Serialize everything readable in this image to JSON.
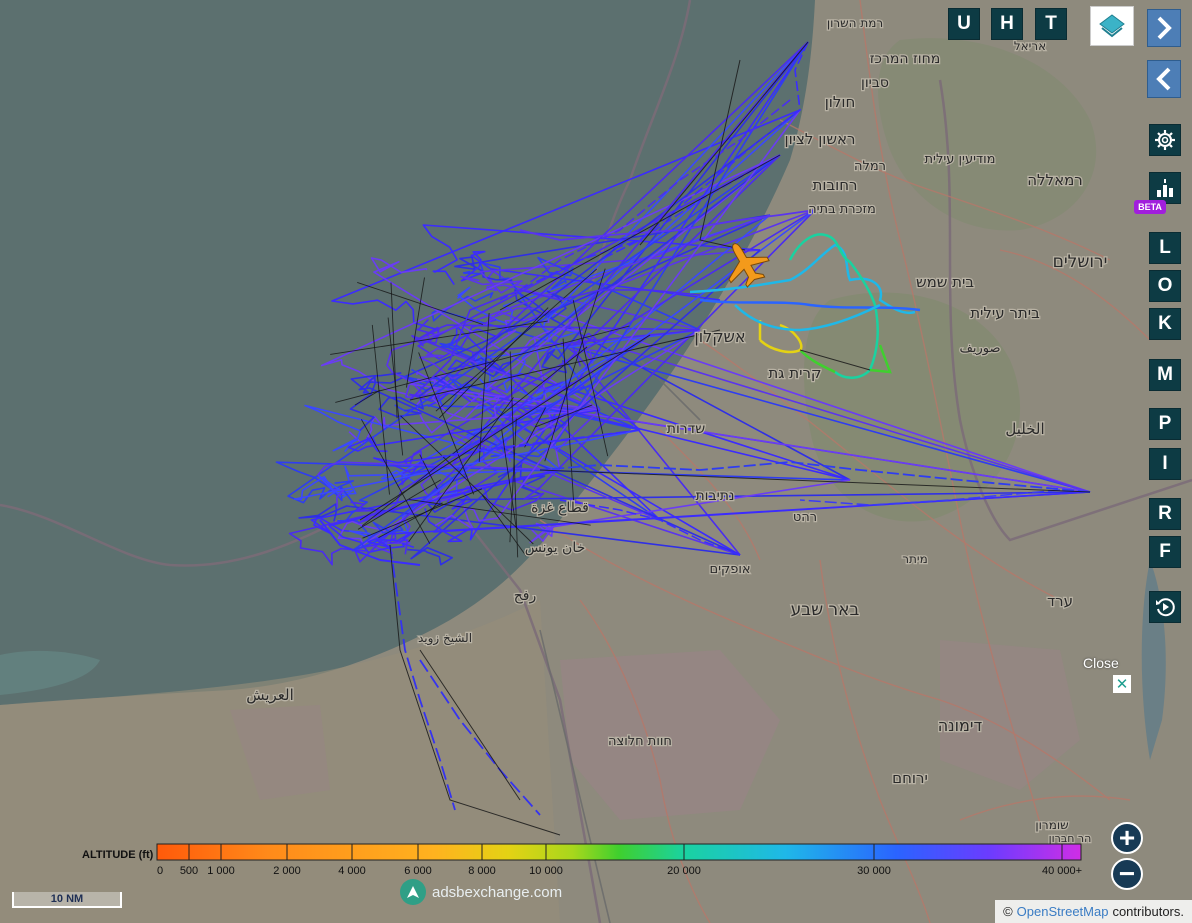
{
  "toolbar_top": {
    "buttons": [
      "U",
      "H",
      "T"
    ]
  },
  "side_buttons": [
    "L",
    "O",
    "K",
    "M",
    "P",
    "I",
    "R",
    "F"
  ],
  "beta_label": "BETA",
  "altitude_legend": {
    "label": "ALTITUDE (ft)",
    "ticks": [
      "0",
      "500",
      "1 000",
      "2 000",
      "4 000",
      "6 000",
      "8 000",
      "10 000",
      "20 000",
      "30 000",
      "40 000+"
    ],
    "colors": [
      "#ff5a0a",
      "#ff7a12",
      "#ff9420",
      "#ffb21f",
      "#e4d214",
      "#a8d71c",
      "#3fd02e",
      "#1ad2a0",
      "#1fb8e8",
      "#2a64ff",
      "#6b3cff",
      "#cf2ee6"
    ]
  },
  "close_label": "Close",
  "scale_label": "10 NM",
  "brand_text": "adsbexchange.com",
  "attribution": {
    "prefix": "©",
    "link": "OpenStreetMap",
    "suffix": "contributors."
  },
  "zoom": {
    "in": "+",
    "out": "−"
  },
  "place_labels": [
    {
      "text": "רמת השרון"
    },
    {
      "text": "אריאל"
    },
    {
      "text": "מחוז המרכז"
    },
    {
      "text": "סביון"
    },
    {
      "text": "חולון"
    },
    {
      "text": "ראשון לציון"
    },
    {
      "text": "רמלה"
    },
    {
      "text": "מודיעין עילית"
    },
    {
      "text": "רחובות"
    },
    {
      "text": "רמאללה"
    },
    {
      "text": "מזכרת בתיה"
    },
    {
      "text": "ירושלים"
    },
    {
      "text": "בית שמש"
    },
    {
      "text": "ביתר עילית"
    },
    {
      "text": "אשקלון"
    },
    {
      "text": "קרית גת"
    },
    {
      "text": "الخليل"
    },
    {
      "text": "שדרות"
    },
    {
      "text": "נתיבות"
    },
    {
      "text": "قطاع غزة"
    },
    {
      "text": "خان يونس"
    },
    {
      "text": "رفح"
    },
    {
      "text": "אופקים"
    },
    {
      "text": "באר שבע"
    },
    {
      "text": "ערד"
    },
    {
      "text": "العريش"
    },
    {
      "text": "الشيخ زويد"
    },
    {
      "text": "דימונה"
    },
    {
      "text": "ירוחם"
    },
    {
      "text": "רהט"
    },
    {
      "text": "מיתר"
    },
    {
      "text": "חוות חלוצה"
    },
    {
      "text": "שומרון"
    },
    {
      "text": "صوريف"
    },
    {
      "text": "הר חברון"
    }
  ]
}
